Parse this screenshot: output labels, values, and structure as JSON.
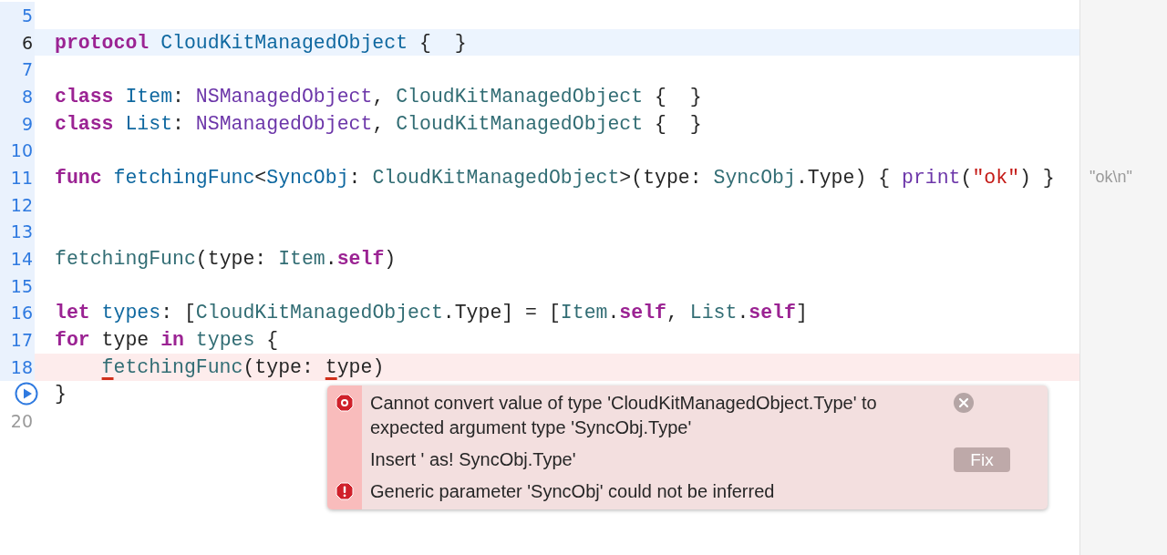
{
  "editor": {
    "lines": [
      {
        "number": "5",
        "executed": true,
        "current": false,
        "error": false
      },
      {
        "number": "6",
        "executed": true,
        "current": true,
        "error": false,
        "tokens": [
          {
            "kind": "keyword",
            "text": "protocol "
          },
          {
            "kind": "decl",
            "text": "CloudKitManagedObject"
          },
          {
            "kind": "plain",
            "text": " {  }"
          }
        ]
      },
      {
        "number": "7",
        "executed": true,
        "current": false,
        "error": false
      },
      {
        "number": "8",
        "executed": true,
        "current": false,
        "error": false,
        "tokens": [
          {
            "kind": "keyword",
            "text": "class "
          },
          {
            "kind": "decl",
            "text": "Item"
          },
          {
            "kind": "plain",
            "text": ": "
          },
          {
            "kind": "system",
            "text": "NSManagedObject"
          },
          {
            "kind": "plain",
            "text": ", "
          },
          {
            "kind": "project",
            "text": "CloudKitManagedObject"
          },
          {
            "kind": "plain",
            "text": " {  }"
          }
        ]
      },
      {
        "number": "9",
        "executed": true,
        "current": false,
        "error": false,
        "tokens": [
          {
            "kind": "keyword",
            "text": "class "
          },
          {
            "kind": "decl",
            "text": "List"
          },
          {
            "kind": "plain",
            "text": ": "
          },
          {
            "kind": "system",
            "text": "NSManagedObject"
          },
          {
            "kind": "plain",
            "text": ", "
          },
          {
            "kind": "project",
            "text": "CloudKitManagedObject"
          },
          {
            "kind": "plain",
            "text": " {  }"
          }
        ]
      },
      {
        "number": "10",
        "executed": true,
        "current": false,
        "error": false
      },
      {
        "number": "11",
        "executed": true,
        "current": false,
        "error": false,
        "result": "\"ok\\n\"",
        "tokens": [
          {
            "kind": "keyword",
            "text": "func "
          },
          {
            "kind": "decl",
            "text": "fetchingFunc"
          },
          {
            "kind": "plain",
            "text": "<"
          },
          {
            "kind": "decl",
            "text": "SyncObj"
          },
          {
            "kind": "plain",
            "text": ": "
          },
          {
            "kind": "project",
            "text": "CloudKitManagedObject"
          },
          {
            "kind": "plain",
            "text": ">(type: "
          },
          {
            "kind": "project",
            "text": "SyncObj"
          },
          {
            "kind": "plain",
            "text": ".Type) { "
          },
          {
            "kind": "system",
            "text": "print"
          },
          {
            "kind": "plain",
            "text": "("
          },
          {
            "kind": "string",
            "text": "\"ok\""
          },
          {
            "kind": "plain",
            "text": ") }"
          }
        ]
      },
      {
        "number": "12",
        "executed": true,
        "current": false,
        "error": false
      },
      {
        "number": "13",
        "executed": true,
        "current": false,
        "error": false
      },
      {
        "number": "14",
        "executed": true,
        "current": false,
        "error": false,
        "tokens": [
          {
            "kind": "project",
            "text": "fetchingFunc"
          },
          {
            "kind": "plain",
            "text": "(type: "
          },
          {
            "kind": "project",
            "text": "Item"
          },
          {
            "kind": "plain",
            "text": "."
          },
          {
            "kind": "keyword",
            "text": "self"
          },
          {
            "kind": "plain",
            "text": ")"
          }
        ]
      },
      {
        "number": "15",
        "executed": true,
        "current": false,
        "error": false
      },
      {
        "number": "16",
        "executed": true,
        "current": false,
        "error": false,
        "tokens": [
          {
            "kind": "keyword",
            "text": "let "
          },
          {
            "kind": "decl",
            "text": "types"
          },
          {
            "kind": "plain",
            "text": ": ["
          },
          {
            "kind": "project",
            "text": "CloudKitManagedObject"
          },
          {
            "kind": "plain",
            "text": ".Type] = ["
          },
          {
            "kind": "project",
            "text": "Item"
          },
          {
            "kind": "plain",
            "text": "."
          },
          {
            "kind": "keyword",
            "text": "self"
          },
          {
            "kind": "plain",
            "text": ", "
          },
          {
            "kind": "project",
            "text": "List"
          },
          {
            "kind": "plain",
            "text": "."
          },
          {
            "kind": "keyword",
            "text": "self"
          },
          {
            "kind": "plain",
            "text": "]"
          }
        ]
      },
      {
        "number": "17",
        "executed": true,
        "current": false,
        "error": false,
        "tokens": [
          {
            "kind": "keyword",
            "text": "for"
          },
          {
            "kind": "plain",
            "text": " type "
          },
          {
            "kind": "keyword",
            "text": "in "
          },
          {
            "kind": "project",
            "text": "types"
          },
          {
            "kind": "plain",
            "text": " {"
          }
        ]
      },
      {
        "number": "18",
        "executed": true,
        "current": false,
        "error": true,
        "indented": true,
        "tokens": [
          {
            "kind": "project",
            "text": "f",
            "underline": true
          },
          {
            "kind": "project",
            "text": "etchingFunc"
          },
          {
            "kind": "plain",
            "text": "(type: "
          },
          {
            "kind": "plain",
            "text": "t",
            "underline": true
          },
          {
            "kind": "plain",
            "text": "ype)"
          }
        ]
      },
      {
        "run_button": true,
        "executed": false,
        "current": false,
        "error": false,
        "tokens": [
          {
            "kind": "plain",
            "text": "}"
          }
        ]
      },
      {
        "number": "20",
        "executed": false,
        "current": false,
        "error": false
      }
    ]
  },
  "issue_popup": {
    "messages": [
      {
        "kind": "error",
        "text": "Cannot convert value of type 'CloudKitManagedObject.Type' to expected argument type 'SyncObj.Type'"
      },
      {
        "kind": "fixit",
        "text": "Insert ' as! SyncObj.Type'",
        "button": "Fix"
      },
      {
        "kind": "error-note",
        "text": "Generic parameter 'SyncObj' could not be inferred"
      }
    ]
  }
}
